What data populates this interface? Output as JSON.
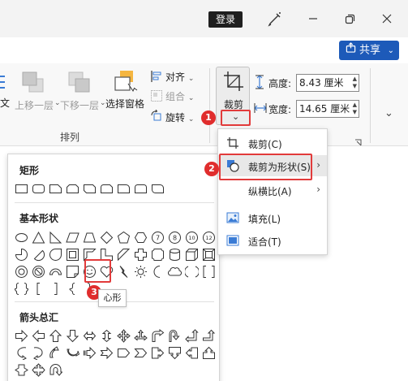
{
  "titlebar": {
    "login_label": "登录",
    "share_label": "共享"
  },
  "ribbon": {
    "left_partial": "文",
    "bring_forward": "上移一层",
    "send_backward": "下移一层",
    "selection_pane": "选择窗格",
    "align": "对齐",
    "group": "组合",
    "rotate": "旋转",
    "arrange_group": "排列",
    "crop_label": "裁剪",
    "height_label": "高度:",
    "height_value": "8.43 厘米",
    "width_label": "宽度:",
    "width_value": "14.65 厘米"
  },
  "crop_menu": {
    "items": [
      {
        "label": "裁剪(C)",
        "icon": "crop-icon",
        "has_submenu": false
      },
      {
        "label": "裁剪为形状(S)",
        "icon": "crop-to-shape-icon",
        "has_submenu": true
      },
      {
        "label": "纵横比(A)",
        "icon": "",
        "has_submenu": true
      },
      {
        "label": "填充(L)",
        "icon": "fill-icon",
        "has_submenu": false
      },
      {
        "label": "适合(T)",
        "icon": "fit-icon",
        "has_submenu": false
      }
    ]
  },
  "shapes_panel": {
    "sections": [
      {
        "title": "矩形"
      },
      {
        "title": "基本形状"
      },
      {
        "title": "箭头总汇"
      }
    ],
    "oct_numbers": [
      "7",
      "8",
      "10",
      "12"
    ],
    "tooltip": "心形"
  },
  "badges": [
    "1",
    "2",
    "3"
  ],
  "colors": {
    "accent": "#1d5ab9",
    "highlight": "#e23b3b",
    "badge": "#e02d2d"
  }
}
